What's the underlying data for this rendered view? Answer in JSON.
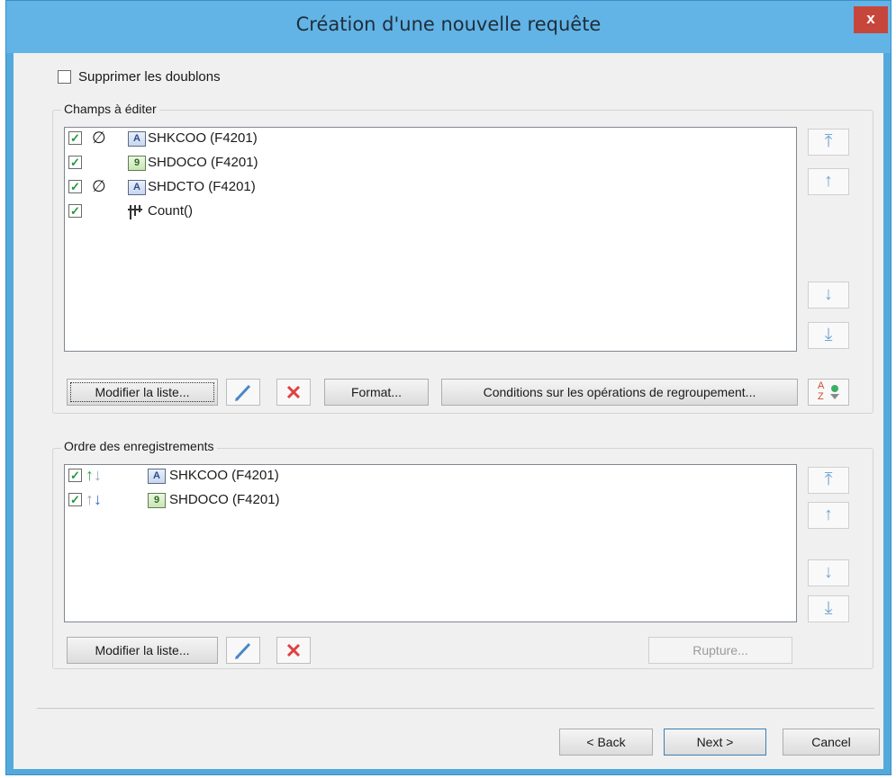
{
  "window": {
    "title": "Création d'une nouvelle requête",
    "close_glyph": "x"
  },
  "options": {
    "remove_duplicates_label": "Supprimer les doublons",
    "remove_duplicates_checked": false
  },
  "fields_group": {
    "title": "Champs à éditer",
    "items": [
      {
        "checked": true,
        "null_symbol": "∅",
        "type_icon": "alpha-type-icon",
        "type_glyph": "A",
        "label": "SHKCOO (F4201)"
      },
      {
        "checked": true,
        "null_symbol": "",
        "type_icon": "numeric-type-icon",
        "type_glyph": "9",
        "label": "SHDOCO (F4201)"
      },
      {
        "checked": true,
        "null_symbol": "∅",
        "type_icon": "alpha-type-icon",
        "type_glyph": "A",
        "label": "SHDCTO (F4201)"
      },
      {
        "checked": true,
        "null_symbol": "",
        "type_icon": "aggregate-icon",
        "type_glyph": "",
        "label": "Count()"
      }
    ],
    "modify_list_label": "Modifier la liste...",
    "format_label": "Format...",
    "group_conditions_label": "Conditions sur les opérations de regroupement...",
    "sort_glyph_top": "A",
    "sort_glyph_bottom": "Z"
  },
  "order_group": {
    "title": "Ordre des enregistrements",
    "items": [
      {
        "checked": true,
        "direction": "ascending",
        "type_icon": "alpha-type-icon",
        "type_glyph": "A",
        "label": "SHKCOO (F4201)"
      },
      {
        "checked": true,
        "direction": "descending",
        "type_icon": "numeric-type-icon",
        "type_glyph": "9",
        "label": "SHDOCO (F4201)"
      }
    ],
    "modify_list_label": "Modifier la liste...",
    "break_label": "Rupture..."
  },
  "move_glyphs": {
    "top": "⤒",
    "up": "↑",
    "down": "↓",
    "bottom": "⤓"
  },
  "footer": {
    "back_label": "< Back",
    "next_label": "Next >",
    "cancel_label": "Cancel"
  },
  "colors": {
    "title_bar": "#62b4e6",
    "close": "#c7463c",
    "check": "#1f9a3a",
    "delete": "#e04040",
    "edit": "#4a87c8"
  }
}
